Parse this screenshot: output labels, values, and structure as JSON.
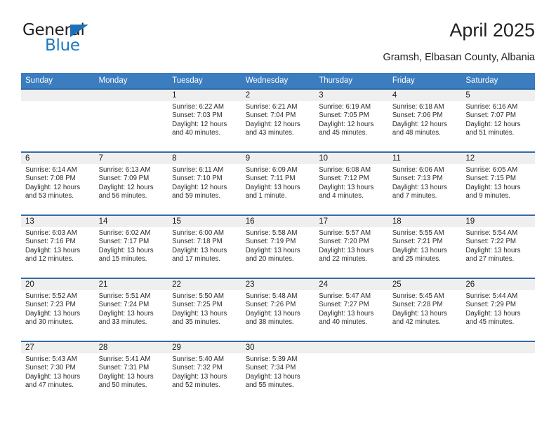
{
  "brand": {
    "name_top": "General",
    "name_bottom": "Blue",
    "triangle_color": "#1c6fb8",
    "text_color_top": "#231f20",
    "text_color_bottom": "#1c79c0"
  },
  "header": {
    "title": "April 2025",
    "location": "Gramsh, Elbasan County, Albania"
  },
  "theme": {
    "header_bg": "#3b7dbf",
    "header_text": "#ffffff",
    "row_divider": "#2f6ca8",
    "daynum_strip_bg": "#efefef",
    "body_text": "#2b2b2b"
  },
  "weekdays": [
    "Sunday",
    "Monday",
    "Tuesday",
    "Wednesday",
    "Thursday",
    "Friday",
    "Saturday"
  ],
  "labels": {
    "sunrise": "Sunrise:",
    "sunset": "Sunset:",
    "daylight": "Daylight:"
  },
  "weeks": [
    [
      {
        "day": "",
        "sunrise": "",
        "sunset": "",
        "daylight": "",
        "empty": true
      },
      {
        "day": "",
        "sunrise": "",
        "sunset": "",
        "daylight": "",
        "empty": true
      },
      {
        "day": "1",
        "sunrise": "Sunrise: 6:22 AM",
        "sunset": "Sunset: 7:03 PM",
        "daylight": "Daylight: 12 hours and 40 minutes.",
        "empty": false
      },
      {
        "day": "2",
        "sunrise": "Sunrise: 6:21 AM",
        "sunset": "Sunset: 7:04 PM",
        "daylight": "Daylight: 12 hours and 43 minutes.",
        "empty": false
      },
      {
        "day": "3",
        "sunrise": "Sunrise: 6:19 AM",
        "sunset": "Sunset: 7:05 PM",
        "daylight": "Daylight: 12 hours and 45 minutes.",
        "empty": false
      },
      {
        "day": "4",
        "sunrise": "Sunrise: 6:18 AM",
        "sunset": "Sunset: 7:06 PM",
        "daylight": "Daylight: 12 hours and 48 minutes.",
        "empty": false
      },
      {
        "day": "5",
        "sunrise": "Sunrise: 6:16 AM",
        "sunset": "Sunset: 7:07 PM",
        "daylight": "Daylight: 12 hours and 51 minutes.",
        "empty": false
      }
    ],
    [
      {
        "day": "6",
        "sunrise": "Sunrise: 6:14 AM",
        "sunset": "Sunset: 7:08 PM",
        "daylight": "Daylight: 12 hours and 53 minutes.",
        "empty": false
      },
      {
        "day": "7",
        "sunrise": "Sunrise: 6:13 AM",
        "sunset": "Sunset: 7:09 PM",
        "daylight": "Daylight: 12 hours and 56 minutes.",
        "empty": false
      },
      {
        "day": "8",
        "sunrise": "Sunrise: 6:11 AM",
        "sunset": "Sunset: 7:10 PM",
        "daylight": "Daylight: 12 hours and 59 minutes.",
        "empty": false
      },
      {
        "day": "9",
        "sunrise": "Sunrise: 6:09 AM",
        "sunset": "Sunset: 7:11 PM",
        "daylight": "Daylight: 13 hours and 1 minute.",
        "empty": false
      },
      {
        "day": "10",
        "sunrise": "Sunrise: 6:08 AM",
        "sunset": "Sunset: 7:12 PM",
        "daylight": "Daylight: 13 hours and 4 minutes.",
        "empty": false
      },
      {
        "day": "11",
        "sunrise": "Sunrise: 6:06 AM",
        "sunset": "Sunset: 7:13 PM",
        "daylight": "Daylight: 13 hours and 7 minutes.",
        "empty": false
      },
      {
        "day": "12",
        "sunrise": "Sunrise: 6:05 AM",
        "sunset": "Sunset: 7:15 PM",
        "daylight": "Daylight: 13 hours and 9 minutes.",
        "empty": false
      }
    ],
    [
      {
        "day": "13",
        "sunrise": "Sunrise: 6:03 AM",
        "sunset": "Sunset: 7:16 PM",
        "daylight": "Daylight: 13 hours and 12 minutes.",
        "empty": false
      },
      {
        "day": "14",
        "sunrise": "Sunrise: 6:02 AM",
        "sunset": "Sunset: 7:17 PM",
        "daylight": "Daylight: 13 hours and 15 minutes.",
        "empty": false
      },
      {
        "day": "15",
        "sunrise": "Sunrise: 6:00 AM",
        "sunset": "Sunset: 7:18 PM",
        "daylight": "Daylight: 13 hours and 17 minutes.",
        "empty": false
      },
      {
        "day": "16",
        "sunrise": "Sunrise: 5:58 AM",
        "sunset": "Sunset: 7:19 PM",
        "daylight": "Daylight: 13 hours and 20 minutes.",
        "empty": false
      },
      {
        "day": "17",
        "sunrise": "Sunrise: 5:57 AM",
        "sunset": "Sunset: 7:20 PM",
        "daylight": "Daylight: 13 hours and 22 minutes.",
        "empty": false
      },
      {
        "day": "18",
        "sunrise": "Sunrise: 5:55 AM",
        "sunset": "Sunset: 7:21 PM",
        "daylight": "Daylight: 13 hours and 25 minutes.",
        "empty": false
      },
      {
        "day": "19",
        "sunrise": "Sunrise: 5:54 AM",
        "sunset": "Sunset: 7:22 PM",
        "daylight": "Daylight: 13 hours and 27 minutes.",
        "empty": false
      }
    ],
    [
      {
        "day": "20",
        "sunrise": "Sunrise: 5:52 AM",
        "sunset": "Sunset: 7:23 PM",
        "daylight": "Daylight: 13 hours and 30 minutes.",
        "empty": false
      },
      {
        "day": "21",
        "sunrise": "Sunrise: 5:51 AM",
        "sunset": "Sunset: 7:24 PM",
        "daylight": "Daylight: 13 hours and 33 minutes.",
        "empty": false
      },
      {
        "day": "22",
        "sunrise": "Sunrise: 5:50 AM",
        "sunset": "Sunset: 7:25 PM",
        "daylight": "Daylight: 13 hours and 35 minutes.",
        "empty": false
      },
      {
        "day": "23",
        "sunrise": "Sunrise: 5:48 AM",
        "sunset": "Sunset: 7:26 PM",
        "daylight": "Daylight: 13 hours and 38 minutes.",
        "empty": false
      },
      {
        "day": "24",
        "sunrise": "Sunrise: 5:47 AM",
        "sunset": "Sunset: 7:27 PM",
        "daylight": "Daylight: 13 hours and 40 minutes.",
        "empty": false
      },
      {
        "day": "25",
        "sunrise": "Sunrise: 5:45 AM",
        "sunset": "Sunset: 7:28 PM",
        "daylight": "Daylight: 13 hours and 42 minutes.",
        "empty": false
      },
      {
        "day": "26",
        "sunrise": "Sunrise: 5:44 AM",
        "sunset": "Sunset: 7:29 PM",
        "daylight": "Daylight: 13 hours and 45 minutes.",
        "empty": false
      }
    ],
    [
      {
        "day": "27",
        "sunrise": "Sunrise: 5:43 AM",
        "sunset": "Sunset: 7:30 PM",
        "daylight": "Daylight: 13 hours and 47 minutes.",
        "empty": false
      },
      {
        "day": "28",
        "sunrise": "Sunrise: 5:41 AM",
        "sunset": "Sunset: 7:31 PM",
        "daylight": "Daylight: 13 hours and 50 minutes.",
        "empty": false
      },
      {
        "day": "29",
        "sunrise": "Sunrise: 5:40 AM",
        "sunset": "Sunset: 7:32 PM",
        "daylight": "Daylight: 13 hours and 52 minutes.",
        "empty": false
      },
      {
        "day": "30",
        "sunrise": "Sunrise: 5:39 AM",
        "sunset": "Sunset: 7:34 PM",
        "daylight": "Daylight: 13 hours and 55 minutes.",
        "empty": false
      },
      {
        "day": "",
        "sunrise": "",
        "sunset": "",
        "daylight": "",
        "empty": true
      },
      {
        "day": "",
        "sunrise": "",
        "sunset": "",
        "daylight": "",
        "empty": true
      },
      {
        "day": "",
        "sunrise": "",
        "sunset": "",
        "daylight": "",
        "empty": true
      }
    ]
  ]
}
